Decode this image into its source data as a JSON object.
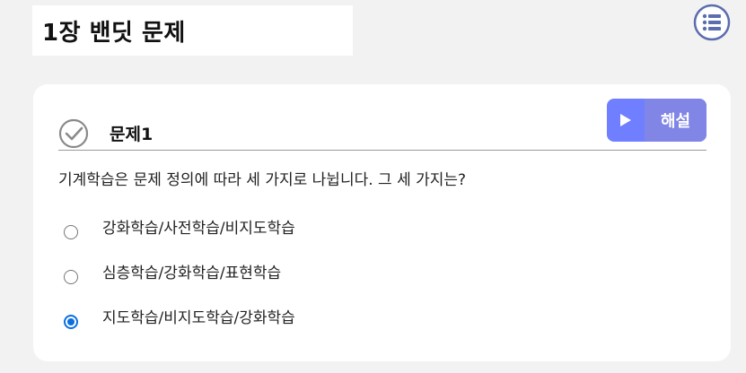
{
  "page": {
    "title": "1장 밴딧 문제",
    "menu_icon": "list-menu-icon"
  },
  "problem": {
    "label": "문제1",
    "status_icon": "check-circle-icon",
    "explain_button": {
      "label": "해설",
      "icon": "play-icon"
    },
    "question": "기계학습은 문제 정의에 따라 세 가지로 나뉩니다. 그 세 가지는?",
    "options": [
      {
        "label": "강화학습/사전학습/비지도학습",
        "selected": false
      },
      {
        "label": "심층학습/강화학습/표현학습",
        "selected": false
      },
      {
        "label": "지도학습/비지도학습/강화학습",
        "selected": true
      }
    ]
  },
  "colors": {
    "accent": "#6f7fff",
    "radio_checked": "#0b6fe0",
    "menu_icon": "#5b6dae"
  }
}
